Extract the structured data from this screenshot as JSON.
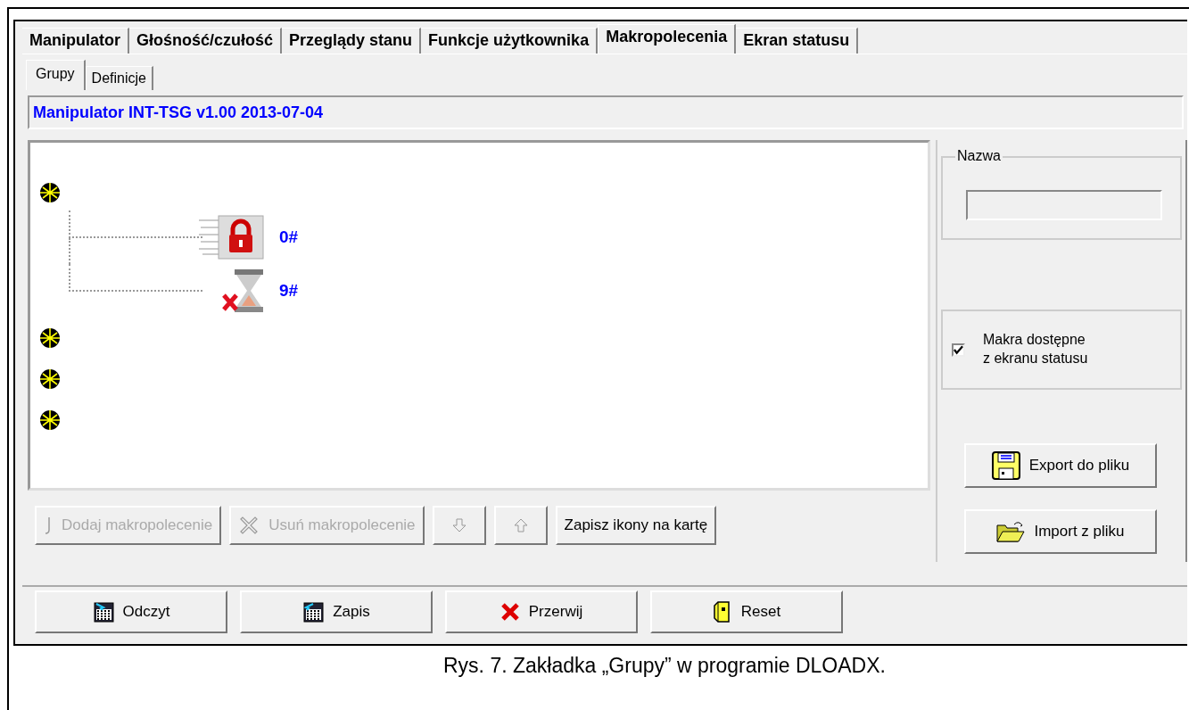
{
  "tabs": [
    {
      "label": "Manipulator",
      "selected": false
    },
    {
      "label": "Głośność/czułość",
      "selected": false
    },
    {
      "label": "Przeglądy stanu",
      "selected": false
    },
    {
      "label": "Funkcje użytkownika",
      "selected": false
    },
    {
      "label": "Makropolecenia",
      "selected": true
    },
    {
      "label": "Ekran statusu",
      "selected": false
    }
  ],
  "subtabs": [
    {
      "label": "Grupy",
      "selected": true
    },
    {
      "label": "Definicje",
      "selected": false
    }
  ],
  "header": "Manipulator INT-TSG v1.00 2013-07-04",
  "tree": [
    {
      "kind": "group",
      "children": [
        {
          "kind": "lock",
          "label": "0#"
        },
        {
          "kind": "timer",
          "label": "9#"
        }
      ]
    },
    {
      "kind": "group"
    },
    {
      "kind": "group"
    },
    {
      "kind": "group"
    }
  ],
  "name_group": {
    "title": "Nazwa"
  },
  "checkbox": {
    "label": "Makra dostępne\nz ekranu statusu",
    "checked": true
  },
  "file_buttons": [
    {
      "kind": "export",
      "label": "Export do pliku"
    },
    {
      "kind": "import",
      "label": "Import z pliku"
    }
  ],
  "tree_buttons": [
    {
      "kind": "add",
      "label": "Dodaj makropolecenie",
      "disabled": true
    },
    {
      "kind": "remove",
      "label": "Usuń makropolecenie",
      "disabled": true
    },
    {
      "kind": "down",
      "disabled": true
    },
    {
      "kind": "up",
      "disabled": true
    },
    {
      "kind": "save",
      "label": "Zapisz ikony na kartę",
      "disabled": false
    }
  ],
  "bottom_buttons": [
    {
      "kind": "read",
      "label": "Odczyt"
    },
    {
      "kind": "write",
      "label": "Zapis"
    },
    {
      "kind": "abort",
      "label": "Przerwij"
    },
    {
      "kind": "reset",
      "label": "Reset"
    }
  ],
  "caption": "Rys. 7. Zakładka „Grupy” w programie DLOADX."
}
